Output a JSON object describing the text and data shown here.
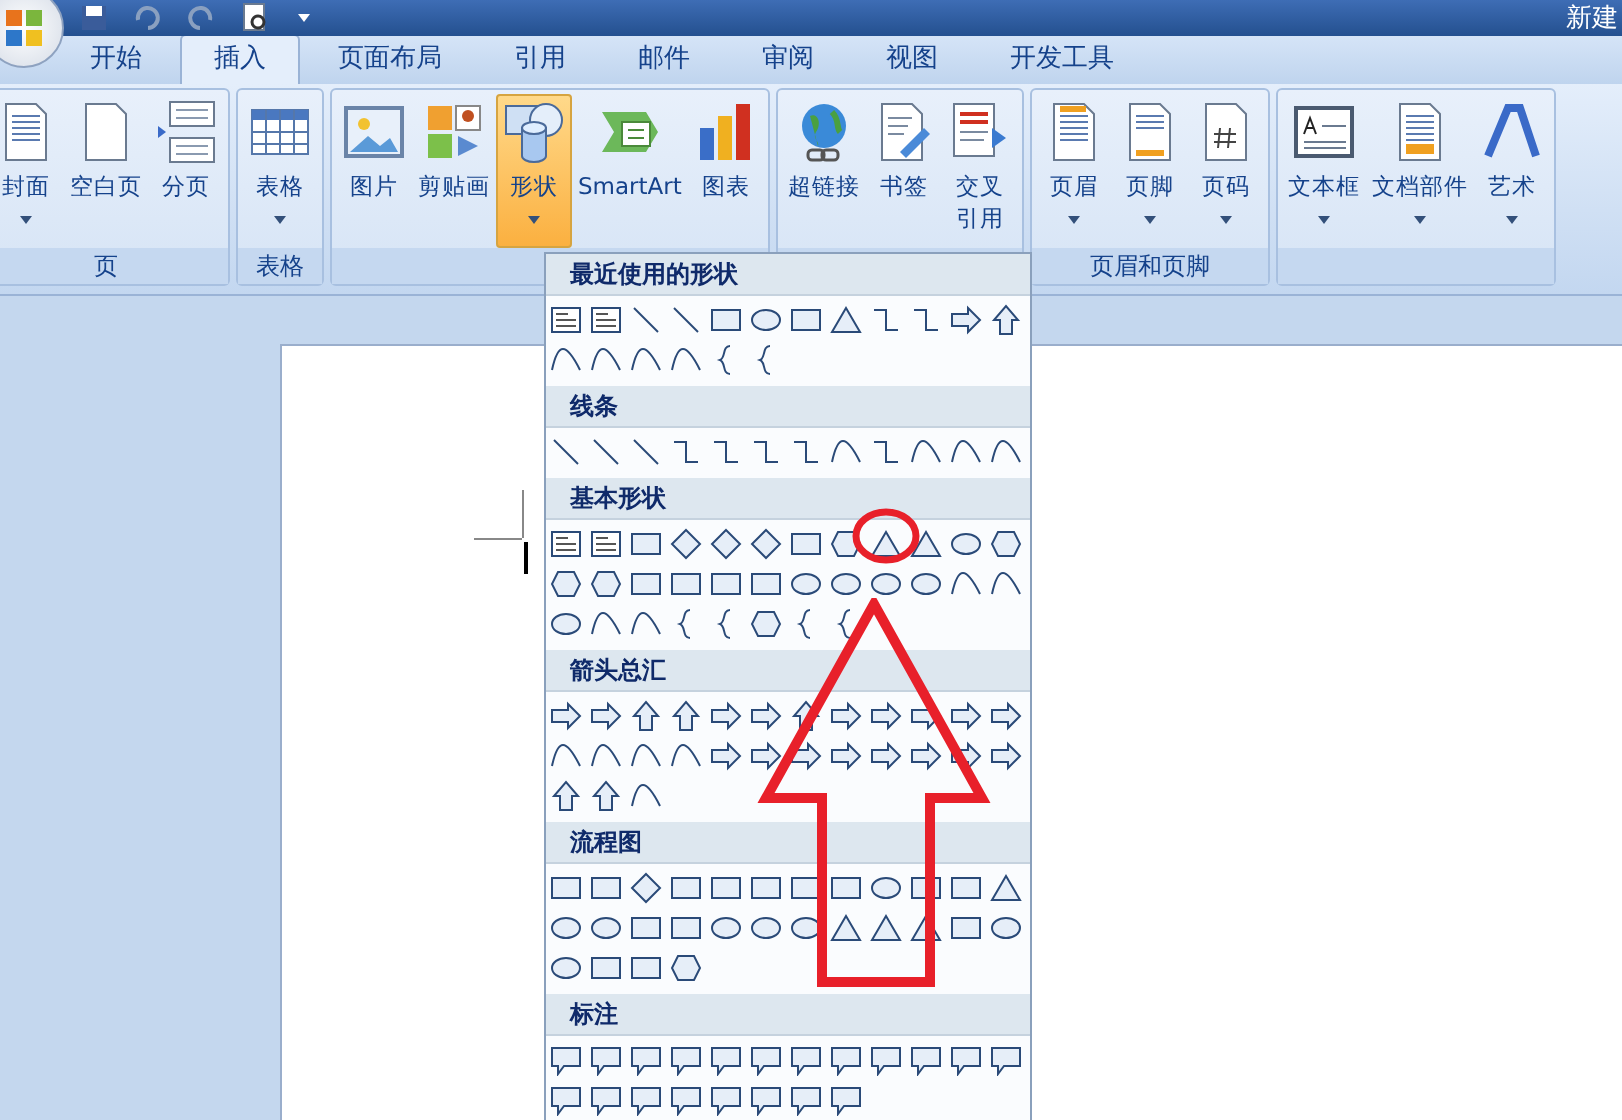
{
  "title_bar": {
    "title": "新建"
  },
  "tabs": [
    {
      "label": "开始",
      "selected": false
    },
    {
      "label": "插入",
      "selected": true
    },
    {
      "label": "页面布局",
      "selected": false
    },
    {
      "label": "引用",
      "selected": false
    },
    {
      "label": "邮件",
      "selected": false
    },
    {
      "label": "审阅",
      "selected": false
    },
    {
      "label": "视图",
      "selected": false
    },
    {
      "label": "开发工具",
      "selected": false
    }
  ],
  "ribbon": {
    "groups": [
      {
        "label": "页",
        "buttons": [
          {
            "label": "封面",
            "kind": "cover",
            "dropdown": true,
            "selected": false
          },
          {
            "label": "空白页",
            "kind": "page",
            "dropdown": false,
            "selected": false
          },
          {
            "label": "分页",
            "kind": "break",
            "dropdown": false,
            "selected": false
          }
        ]
      },
      {
        "label": "表格",
        "buttons": [
          {
            "label": "表格",
            "kind": "table",
            "dropdown": true,
            "selected": false
          }
        ]
      },
      {
        "buttons": [
          {
            "label": "图片",
            "kind": "picture",
            "dropdown": false,
            "selected": false
          },
          {
            "label": "剪贴画",
            "kind": "clipart",
            "dropdown": false,
            "selected": false
          },
          {
            "label": "形状",
            "kind": "shapes",
            "dropdown": true,
            "selected": true
          },
          {
            "label": "SmartArt",
            "kind": "smartart",
            "dropdown": false,
            "selected": false
          },
          {
            "label": "图表",
            "kind": "chart",
            "dropdown": false,
            "selected": false
          }
        ]
      },
      {
        "buttons": [
          {
            "label": "超链接",
            "kind": "globe",
            "dropdown": false,
            "selected": false
          },
          {
            "label": "书签",
            "kind": "bookmark",
            "dropdown": false,
            "selected": false
          },
          {
            "label": "交叉引用",
            "kind": "crossref",
            "dropdown": false,
            "selected": false
          }
        ]
      },
      {
        "label": "页眉和页脚",
        "buttons": [
          {
            "label": "页眉",
            "kind": "header",
            "dropdown": true,
            "selected": false
          },
          {
            "label": "页脚",
            "kind": "footer",
            "dropdown": true,
            "selected": false
          },
          {
            "label": "页码",
            "kind": "pagenum",
            "dropdown": true,
            "selected": false
          }
        ]
      },
      {
        "buttons": [
          {
            "label": "文本框",
            "kind": "textbox",
            "dropdown": true,
            "selected": false
          },
          {
            "label": "文档部件",
            "kind": "parts",
            "dropdown": true,
            "selected": false
          },
          {
            "label": "艺术",
            "kind": "wordart",
            "dropdown": true,
            "selected": false
          }
        ]
      }
    ]
  },
  "shapes_menu": {
    "sections": [
      {
        "title": "最近使用的形状"
      },
      {
        "title": "线条"
      },
      {
        "title": "基本形状"
      },
      {
        "title": "箭头总汇"
      },
      {
        "title": "流程图"
      },
      {
        "title": "标注"
      }
    ]
  }
}
